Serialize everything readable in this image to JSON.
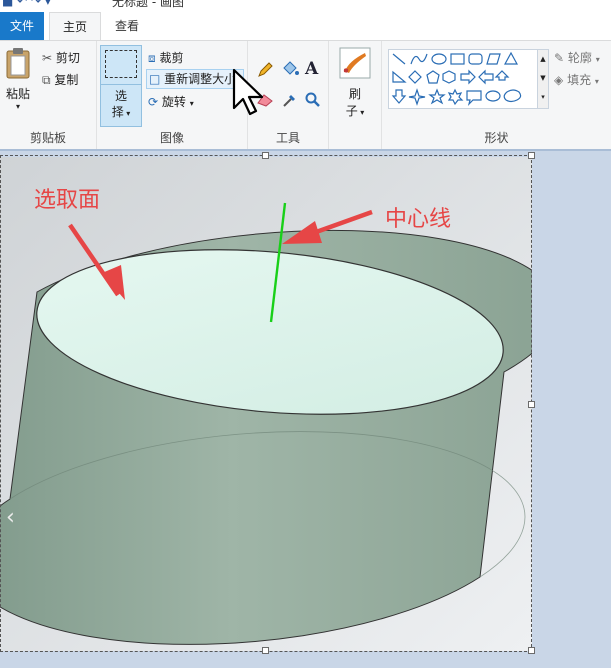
{
  "window": {
    "title": "无标题 - 画图"
  },
  "tabs": {
    "file": "文件",
    "home": "主页",
    "view": "查看"
  },
  "clipboard": {
    "paste": "粘贴",
    "cut": "剪切",
    "copy": "复制",
    "group": "剪贴板"
  },
  "image": {
    "select_line1": "选",
    "select_line2": "择",
    "crop": "裁剪",
    "resize": "重新调整大小",
    "rotate": "旋转",
    "group": "图像"
  },
  "tools": {
    "group": "工具",
    "text_glyph": "A"
  },
  "brushes": {
    "line1": "刷",
    "line2": "子"
  },
  "shapes": {
    "group": "形状",
    "outline": "轮廓",
    "fill": "填充"
  },
  "annotations": {
    "selected_face": "选取面",
    "center_line": "中心线"
  },
  "colors": {
    "accent": "#1979ca",
    "annotation": "#e64646",
    "center_line": "#18d018",
    "top_face": "#d9f3ea",
    "body": "#8fa89a"
  }
}
